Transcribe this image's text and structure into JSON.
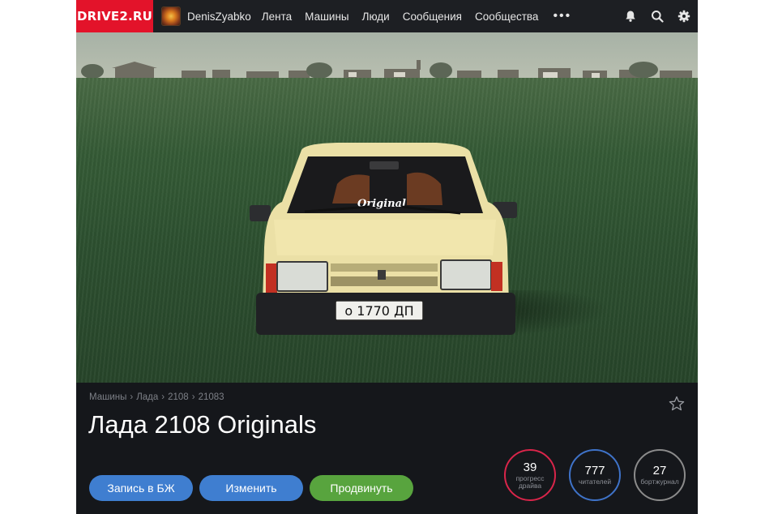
{
  "header": {
    "logo": "DRIVE2.RU",
    "username": "DenisZyabko",
    "nav": [
      "Лента",
      "Машины",
      "Люди",
      "Сообщения",
      "Сообщества"
    ],
    "more": "•••",
    "icons": [
      "bell-icon",
      "search-icon",
      "gear-icon"
    ]
  },
  "photo": {
    "plate_text": "о 1770 ДП",
    "windshield_sticker": "Original"
  },
  "car": {
    "breadcrumbs": [
      "Машины",
      "Лада",
      "2108",
      "21083"
    ],
    "breadcrumb_separator": "›",
    "title": "Лада 2108 Originals",
    "buttons": {
      "logbook": "Запись в БЖ",
      "edit": "Изменить",
      "promote": "Продвинуть"
    },
    "stats": [
      {
        "value": "39",
        "label": "прогресс драйва",
        "color": "#d9254a"
      },
      {
        "value": "777",
        "label": "читателей",
        "color": "#3f73c9"
      },
      {
        "value": "27",
        "label": "бортжурнал",
        "color": "#8b8b8b"
      }
    ]
  },
  "colors": {
    "brand": "#e3132a",
    "button_blue": "#3f7ed0",
    "button_green": "#58a43e",
    "panel_bg": "#15171b"
  }
}
